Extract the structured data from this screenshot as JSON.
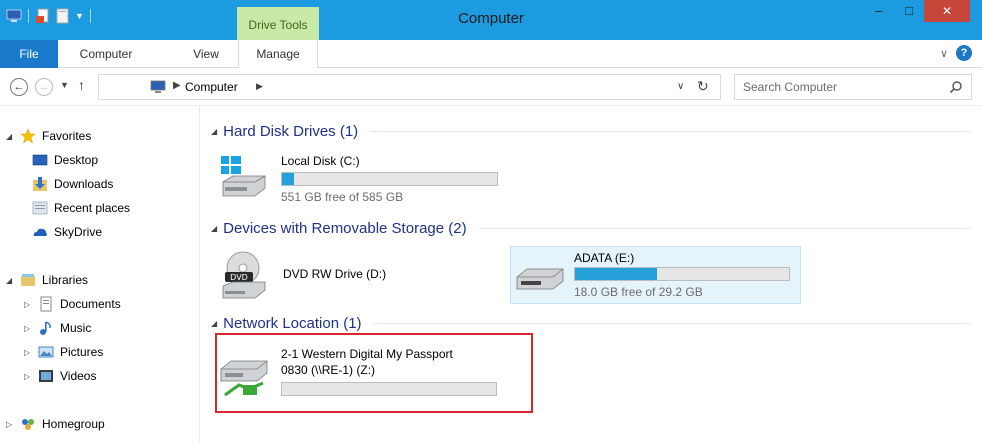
{
  "window": {
    "title": "Computer",
    "context_tab": "Drive Tools",
    "minimize": "–",
    "maximize": "□",
    "close": "✕"
  },
  "ribbon": {
    "tabs": [
      {
        "label": "File",
        "active": false
      },
      {
        "label": "Computer",
        "active": false
      },
      {
        "label": "View",
        "active": false
      },
      {
        "label": "Manage",
        "active": true
      }
    ]
  },
  "address": {
    "path": "Computer",
    "search_placeholder": "Search Computer"
  },
  "nav": {
    "favorites": "Favorites",
    "desktop": "Desktop",
    "downloads": "Downloads",
    "recent": "Recent places",
    "skydrive": "SkyDrive",
    "libraries": "Libraries",
    "documents": "Documents",
    "music": "Music",
    "pictures": "Pictures",
    "videos": "Videos",
    "homegroup": "Homegroup"
  },
  "groups": {
    "hdd": {
      "title": "Hard Disk Drives (1)",
      "drives": [
        {
          "name": "Local Disk (C:)",
          "free": "551 GB free of 585 GB",
          "used_fraction": 0.058
        }
      ]
    },
    "removable": {
      "title": "Devices with Removable Storage (2)",
      "drives": [
        {
          "name": "DVD RW Drive (D:)"
        },
        {
          "name": "ADATA (E:)",
          "free": "18.0 GB free of 29.2 GB",
          "used_fraction": 0.384
        }
      ]
    },
    "network": {
      "title": "Network Location (1)",
      "drives": [
        {
          "name": "2-1 Western Digital My Passport",
          "name2": "0830 (\\\\RE-1) (Z:)",
          "used_fraction": 0.0
        }
      ]
    }
  },
  "colors": {
    "titlebar": "#1c9be0",
    "file_tab": "#1979ca",
    "context_tab": "#c9e9a8",
    "group_title": "#1e3287",
    "progress": "#26a0da",
    "highlight": "#d9272b",
    "close_button": "#c7463a"
  }
}
